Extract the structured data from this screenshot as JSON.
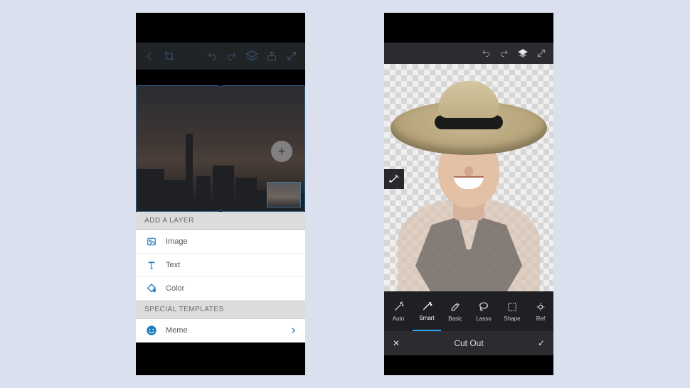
{
  "left": {
    "sections": {
      "add_layer_header": "ADD A LAYER",
      "special_templates_header": "SPECIAL TEMPLATES"
    },
    "rows": {
      "image": "Image",
      "text": "Text",
      "color": "Color",
      "meme": "Meme"
    },
    "add_button_glyph": "+"
  },
  "right": {
    "tools": {
      "auto": "Auto",
      "smart": "Smart",
      "basic": "Basic",
      "lasso": "Lasso",
      "shape": "Shape",
      "refine": "Ref"
    },
    "bottom": {
      "title": "Cut Out",
      "close_glyph": "✕",
      "confirm_glyph": "✓"
    }
  }
}
